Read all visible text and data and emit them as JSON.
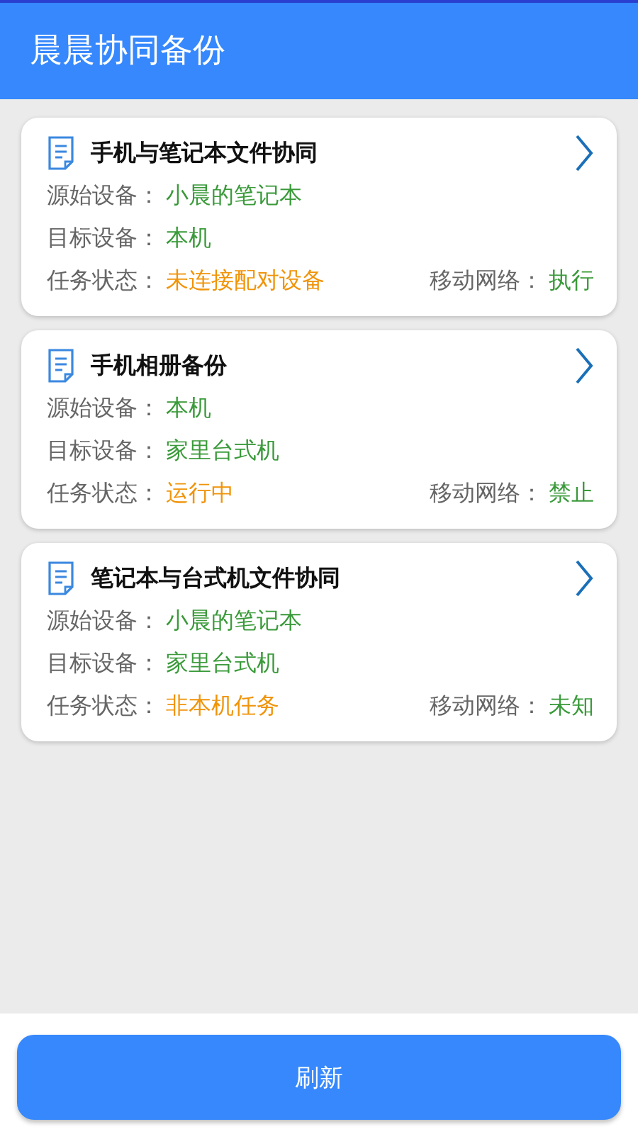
{
  "app_bar": {
    "title": "晨晨协同备份"
  },
  "tasks": [
    {
      "name": "手机与笔记本文件协同",
      "source_label": "源始设备：",
      "source": "小晨的笔记本",
      "target_label": "目标设备：",
      "target": "本机",
      "status_label": "任务状态：",
      "status": "未连接配对设备",
      "network_label": "移动网络：",
      "network": "执行"
    },
    {
      "name": "手机相册备份",
      "source_label": "源始设备：",
      "source": "本机",
      "target_label": "目标设备：",
      "target": "家里台式机",
      "status_label": "任务状态：",
      "status": "运行中",
      "network_label": "移动网络：",
      "network": "禁止"
    },
    {
      "name": "笔记本与台式机文件协同",
      "source_label": "源始设备：",
      "source": "小晨的笔记本",
      "target_label": "目标设备：",
      "target": "家里台式机",
      "status_label": "任务状态：",
      "status": "非本机任务",
      "network_label": "移动网络：",
      "network": "未知"
    }
  ],
  "refresh_button": {
    "label": "刷新"
  }
}
